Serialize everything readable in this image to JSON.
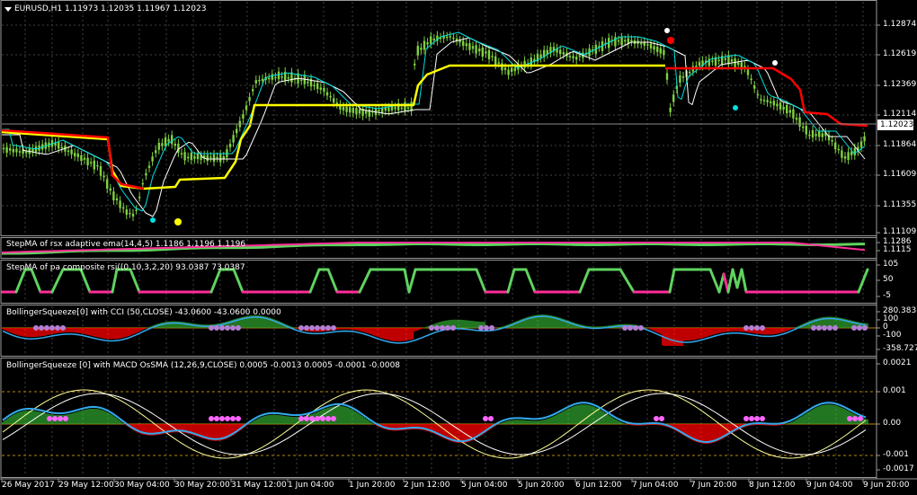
{
  "colors": {
    "background": "#000000",
    "candle": "#7fd140",
    "up_line": "#ffff00",
    "down_line": "#ff0000",
    "ma_white": "#ffffff",
    "ma_cyan": "#00e0e0",
    "step_green": "#5fd35f",
    "step_magenta": "#ff2d9a",
    "cci_fill": "#2e9e2e",
    "neg_fill": "#ff0000",
    "squeeze_dot": "#b57fd6",
    "grid": "#404040",
    "gold_line": "#b8860b"
  },
  "main": {
    "title": "EURUSD,H1  1.11973 1.12035 1.11967 1.12023",
    "price_labels": [
      "1.12874",
      "1.12619",
      "1.12369",
      "1.12114",
      "1.11864",
      "1.11609",
      "1.11355",
      "1.11109"
    ],
    "current_price": "1.12023"
  },
  "panel1": {
    "title": "StepMA of rsx adaptive ema(14,4,5) 1.1186 1.1196 1.1196",
    "labels": [
      "1.1286",
      "1.1115"
    ]
  },
  "panel2": {
    "title": "StepMA of pa composite rsi((0.10,3,2,20) 93.0387 73.0387",
    "labels": [
      "105",
      "50",
      "-5"
    ]
  },
  "panel3": {
    "title": "BollingerSqueeze[0] with CCI (50,CLOSE) -43.0600 -43.0600 0.0000",
    "labels": [
      "280.3838",
      "100",
      "0",
      "-100",
      "-358.7275"
    ]
  },
  "panel4": {
    "title": "BollingerSqueeze [0] with MACD OsSMA (12,26,9,CLOSE) 0.0005 -0.0013 0.0005 -0.0001 -0.0008",
    "labels": [
      "0.0021",
      "0.001",
      "0.00",
      "-0.001",
      "-0.0017"
    ]
  },
  "time_labels": [
    "26 May 2017",
    "29 May 12:00",
    "30 May 04:00",
    "30 May 20:00",
    "31 May 12:00",
    "1 Jun 04:00",
    "1 Jun 20:00",
    "2 Jun 12:00",
    "5 Jun 04:00",
    "5 Jun 20:00",
    "6 Jun 12:00",
    "7 Jun 04:00",
    "7 Jun 20:00",
    "8 Jun 12:00",
    "9 Jun 04:00",
    "9 Jun 20:00"
  ]
}
